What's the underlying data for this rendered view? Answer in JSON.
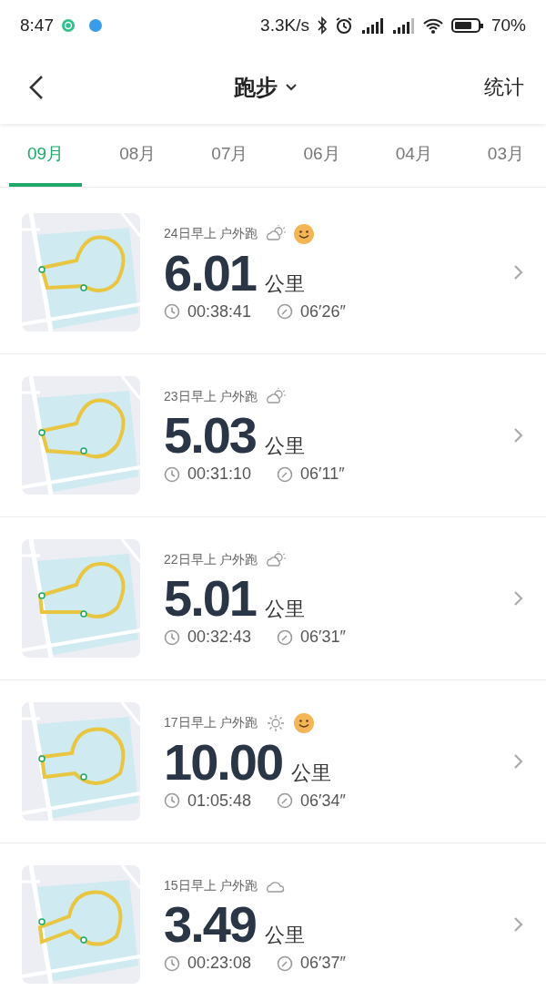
{
  "status_bar": {
    "time": "8:47",
    "speed": "3.3K/s",
    "battery": "70%"
  },
  "header": {
    "title": "跑步",
    "action": "统计"
  },
  "tabs": [
    {
      "label": "09月",
      "selected": true
    },
    {
      "label": "08月",
      "selected": false
    },
    {
      "label": "07月",
      "selected": false
    },
    {
      "label": "06月",
      "selected": false
    },
    {
      "label": "04月",
      "selected": false
    },
    {
      "label": "03月",
      "selected": false
    }
  ],
  "runs": [
    {
      "when": "24日早上 户外跑",
      "weather": {
        "kind": "partly_cloudy"
      },
      "smiley": true,
      "distance": "6.01",
      "unit": "公里",
      "duration": "00:38:41",
      "pace": "06′26″"
    },
    {
      "when": "23日早上 户外跑",
      "weather": {
        "kind": "partly_cloudy"
      },
      "smiley": false,
      "distance": "5.03",
      "unit": "公里",
      "duration": "00:31:10",
      "pace": "06′11″"
    },
    {
      "when": "22日早上 户外跑",
      "weather": {
        "kind": "partly_cloudy"
      },
      "smiley": false,
      "distance": "5.01",
      "unit": "公里",
      "duration": "00:32:43",
      "pace": "06′31″"
    },
    {
      "when": "17日早上 户外跑",
      "weather": {
        "kind": "sunny"
      },
      "smiley": true,
      "distance": "10.00",
      "unit": "公里",
      "duration": "01:05:48",
      "pace": "06′34″"
    },
    {
      "when": "15日早上 户外跑",
      "weather": {
        "kind": "cloudy"
      },
      "smiley": false,
      "distance": "3.49",
      "unit": "公里",
      "duration": "00:23:08",
      "pace": "06′37″"
    }
  ]
}
